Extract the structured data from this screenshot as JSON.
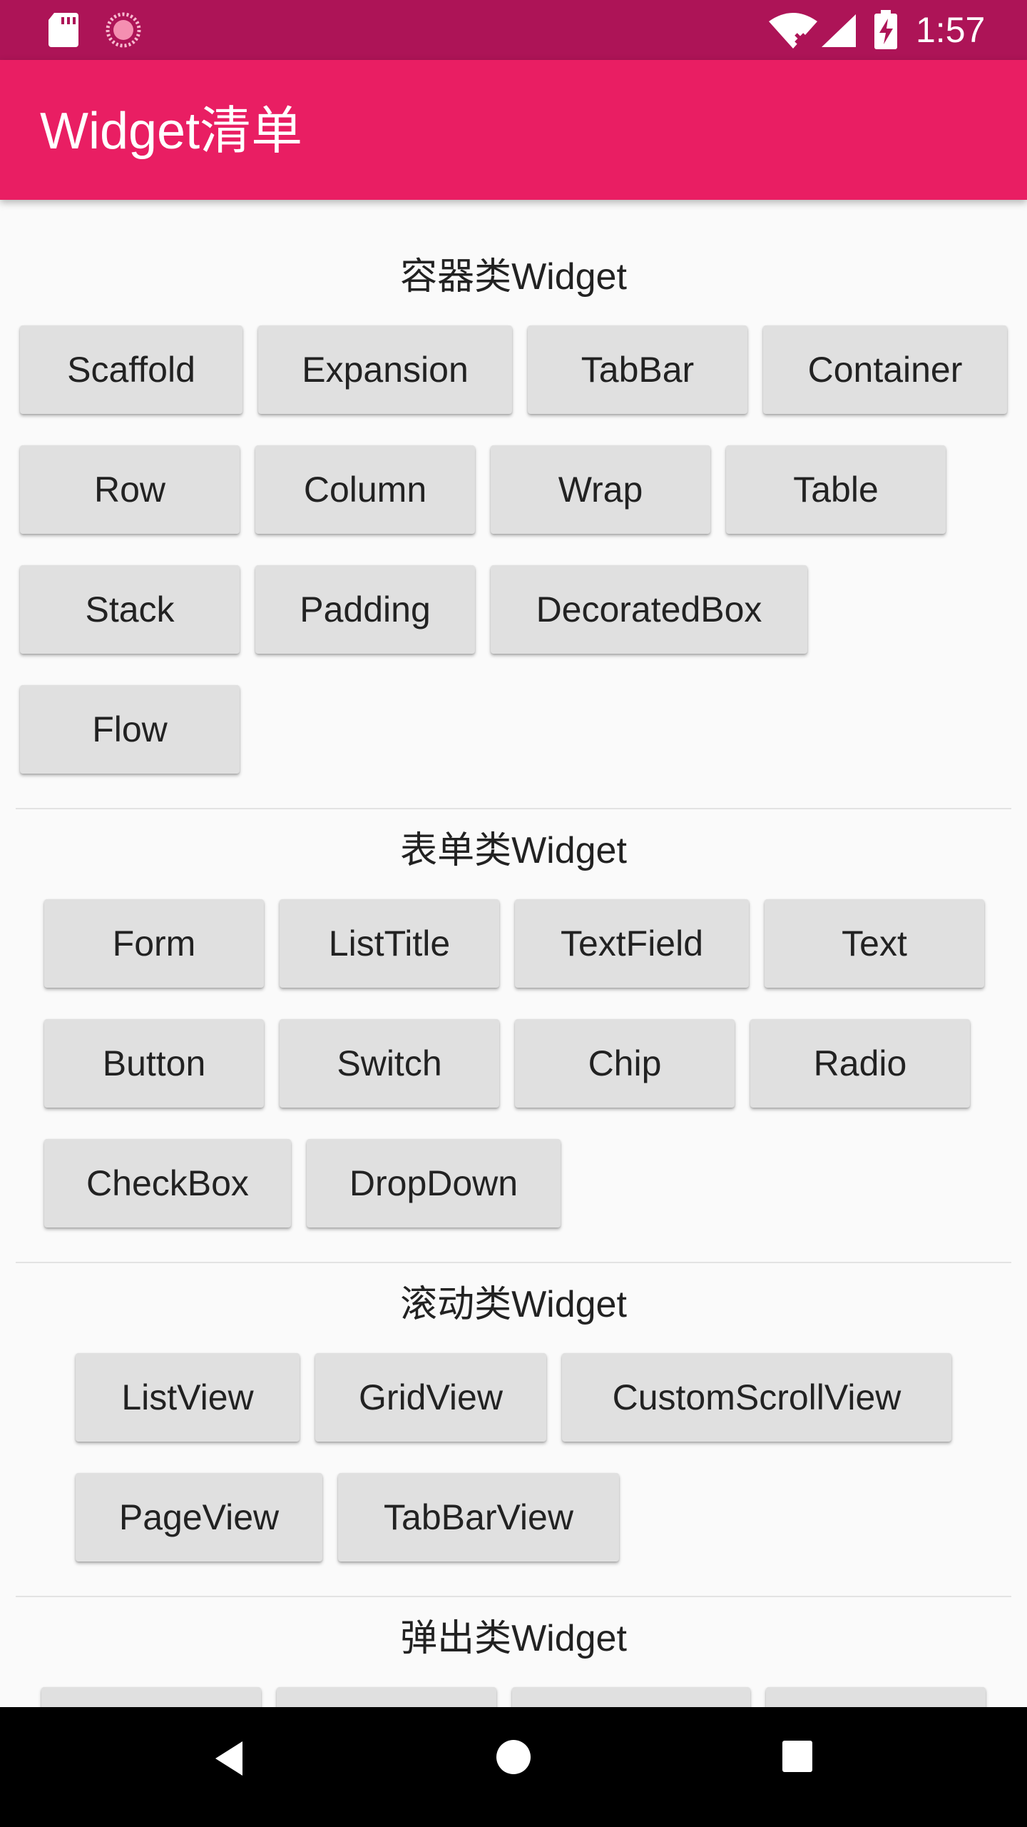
{
  "status_bar": {
    "time": "1:57",
    "icons": [
      "sd-card-icon",
      "sync-icon",
      "wifi-icon",
      "signal-icon",
      "battery-charging-icon"
    ]
  },
  "app_bar": {
    "title": "Widget清单",
    "color": "#e91e63",
    "status_color": "#ad1457"
  },
  "sections": [
    {
      "title": "容器类Widget",
      "items": [
        "Scaffold",
        "Expansion",
        "TabBar",
        "Container",
        "Row",
        "Column",
        "Wrap",
        "Table",
        "Stack",
        "Padding",
        "DecoratedBox",
        "Flow"
      ]
    },
    {
      "title": "表单类Widget",
      "items": [
        "Form",
        "ListTitle",
        "TextField",
        "Text",
        "Button",
        "Switch",
        "Chip",
        "Radio",
        "CheckBox",
        "DropDown"
      ]
    },
    {
      "title": "滚动类Widget",
      "items": [
        "ListView",
        "GridView",
        "CustomScrollView",
        "PageView",
        "TabBarView"
      ]
    },
    {
      "title": "弹出类Widget",
      "items": [
        "",
        "",
        "",
        ""
      ]
    }
  ],
  "nav_bar": {
    "buttons": [
      "back-icon",
      "home-icon",
      "recents-icon"
    ]
  }
}
